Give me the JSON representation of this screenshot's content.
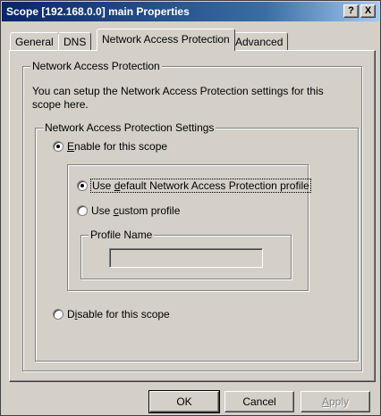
{
  "window": {
    "title": "Scope [192.168.0.0] main Properties",
    "help_button": "?",
    "close_button": "X"
  },
  "tabs": [
    {
      "label": "General",
      "active": false
    },
    {
      "label": "DNS",
      "active": false
    },
    {
      "label": "Network Access Protection",
      "active": true
    },
    {
      "label": "Advanced",
      "active": false
    }
  ],
  "nap_group": {
    "legend": "Network Access Protection",
    "description": "You can setup the Network Access Protection settings for this scope here."
  },
  "settings_group": {
    "legend": "Network Access Protection Settings",
    "enable_option": {
      "prefix": "",
      "accel": "E",
      "rest": "nable for this scope",
      "selected": true
    },
    "disable_option": {
      "prefix": "D",
      "accel": "i",
      "rest": "sable for this scope",
      "selected": false
    }
  },
  "profile_options": {
    "default_option": {
      "prefix": "Use ",
      "accel": "d",
      "rest": "efault Network Access Protection profile",
      "selected": true
    },
    "custom_option": {
      "prefix": "Use ",
      "accel": "c",
      "rest": "ustom profile",
      "selected": false
    }
  },
  "profile_name": {
    "legend": "Profile Name",
    "value": ""
  },
  "buttons": {
    "ok": "OK",
    "cancel": "Cancel",
    "apply_accel": "A",
    "apply_rest": "pply"
  }
}
